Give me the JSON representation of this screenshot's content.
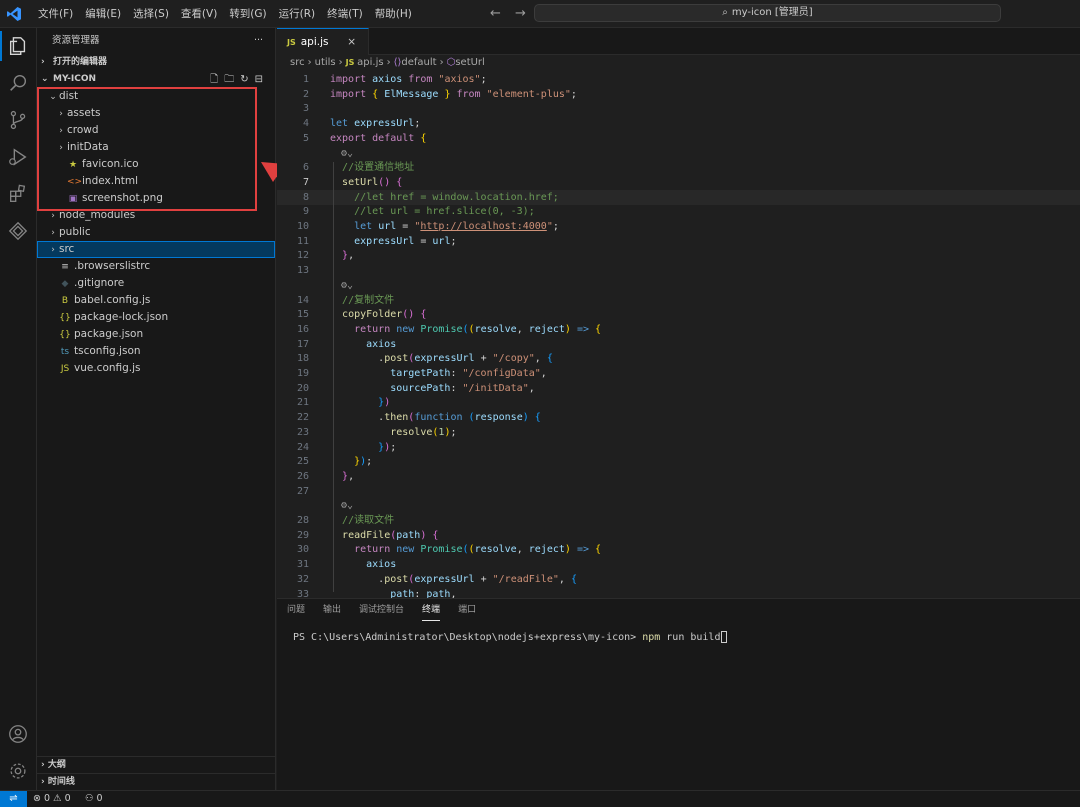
{
  "titlebar": {
    "menu": [
      "文件(F)",
      "编辑(E)",
      "选择(S)",
      "查看(V)",
      "转到(G)",
      "运行(R)",
      "终端(T)",
      "帮助(H)"
    ],
    "search_text": "my-icon [管理员]",
    "back_arrow": "←",
    "forward_arrow": "→"
  },
  "sidebar": {
    "title": "资源管理器",
    "more": "···",
    "open_editors": "打开的编辑器",
    "project": "MY-ICON",
    "tree": [
      {
        "label": "dist",
        "depth": 1,
        "chev": "⌄",
        "icon": "",
        "icon_color": ""
      },
      {
        "label": "assets",
        "depth": 2,
        "chev": "›",
        "icon": "",
        "icon_color": ""
      },
      {
        "label": "crowd",
        "depth": 2,
        "chev": "›",
        "icon": "",
        "icon_color": ""
      },
      {
        "label": "initData",
        "depth": 2,
        "chev": "›",
        "icon": "",
        "icon_color": ""
      },
      {
        "label": "favicon.ico",
        "depth": 2,
        "chev": "",
        "icon": "★",
        "icon_color": "#cbcb41"
      },
      {
        "label": "index.html",
        "depth": 2,
        "chev": "",
        "icon": "<>",
        "icon_color": "#e37933"
      },
      {
        "label": "screenshot.png",
        "depth": 2,
        "chev": "",
        "icon": "▣",
        "icon_color": "#a074c4"
      },
      {
        "label": "node_modules",
        "depth": 1,
        "chev": "›",
        "icon": "",
        "icon_color": ""
      },
      {
        "label": "public",
        "depth": 1,
        "chev": "›",
        "icon": "",
        "icon_color": ""
      },
      {
        "label": "src",
        "depth": 1,
        "chev": "›",
        "icon": "",
        "icon_color": "",
        "selected": true
      },
      {
        "label": ".browserslistrc",
        "depth": 1,
        "chev": "",
        "icon": "≡",
        "icon_color": "#cccccc"
      },
      {
        "label": ".gitignore",
        "depth": 1,
        "chev": "",
        "icon": "◆",
        "icon_color": "#41535b"
      },
      {
        "label": "babel.config.js",
        "depth": 1,
        "chev": "",
        "icon": "B",
        "icon_color": "#cbcb41"
      },
      {
        "label": "package-lock.json",
        "depth": 1,
        "chev": "",
        "icon": "{}",
        "icon_color": "#cbcb41"
      },
      {
        "label": "package.json",
        "depth": 1,
        "chev": "",
        "icon": "{}",
        "icon_color": "#cbcb41"
      },
      {
        "label": "tsconfig.json",
        "depth": 1,
        "chev": "",
        "icon": "ts",
        "icon_color": "#519aba"
      },
      {
        "label": "vue.config.js",
        "depth": 1,
        "chev": "",
        "icon": "JS",
        "icon_color": "#cbcb41"
      }
    ],
    "outline": "大纲",
    "timeline": "时间线"
  },
  "editor": {
    "tab_label": "api.js",
    "tab_close": "×",
    "breadcrumb": [
      "src",
      "utils",
      "api.js",
      "default",
      "setUrl"
    ]
  },
  "code_lines": [
    {
      "n": "1",
      "html": "<span class='kc'>import</span> <span class='var'>axios</span> <span class='kc'>from</span> <span class='str'>\"axios\"</span><span class='pn'>;</span>"
    },
    {
      "n": "2",
      "html": "<span class='kc'>import</span> <span class='br1'>{</span> <span class='var'>ElMessage</span> <span class='br1'>}</span> <span class='kc'>from</span> <span class='str'>\"element-plus\"</span><span class='pn'>;</span>"
    },
    {
      "n": "3",
      "html": ""
    },
    {
      "n": "4",
      "html": "<span class='kw'>let</span> <span class='var'>expressUrl</span><span class='pn'>;</span>"
    },
    {
      "n": "5",
      "html": "<span class='kc'>export</span> <span class='kc'>default</span> <span class='br1'>{</span>"
    },
    {
      "n": "",
      "lens": true
    },
    {
      "n": "6",
      "html": "  <span class='cm'>//设置通信地址</span>"
    },
    {
      "n": "7",
      "html": "  <span class='fn'>setUrl</span><span class='br2'>()</span> <span class='br2'>{</span>",
      "cur": true
    },
    {
      "n": "8",
      "html": "    <span class='cm'>//let href = window.location.href;</span>",
      "hl": true
    },
    {
      "n": "9",
      "html": "    <span class='cm'>//let url = href.slice(0, -3);</span>"
    },
    {
      "n": "10",
      "html": "    <span class='kw'>let</span> <span class='var'>url</span> <span class='pn'>=</span> <span class='str'>\"</span><span class='url'>http://localhost:4000</span><span class='str'>\"</span><span class='pn'>;</span>"
    },
    {
      "n": "11",
      "html": "    <span class='var'>expressUrl</span> <span class='pn'>=</span> <span class='var'>url</span><span class='pn'>;</span>"
    },
    {
      "n": "12",
      "html": "  <span class='br2'>}</span><span class='pn'>,</span>"
    },
    {
      "n": "13",
      "html": ""
    },
    {
      "n": "",
      "lens": true
    },
    {
      "n": "14",
      "html": "  <span class='cm'>//复制文件</span>"
    },
    {
      "n": "15",
      "html": "  <span class='fn'>copyFolder</span><span class='br2'>()</span> <span class='br2'>{</span>"
    },
    {
      "n": "16",
      "html": "    <span class='kc'>return</span> <span class='kw'>new</span> <span class='cls'>Promise</span><span class='br3'>(</span><span class='br1'>(</span><span class='var'>resolve</span><span class='pn'>,</span> <span class='var'>reject</span><span class='br1'>)</span> <span class='kw'>=&gt;</span> <span class='br1'>{</span>"
    },
    {
      "n": "17",
      "html": "      <span class='var'>axios</span>"
    },
    {
      "n": "18",
      "html": "        <span class='pn'>.</span><span class='fn'>post</span><span class='br2'>(</span><span class='var'>expressUrl</span> <span class='pn'>+</span> <span class='str'>\"/copy\"</span><span class='pn'>,</span> <span class='br3'>{</span>"
    },
    {
      "n": "19",
      "html": "          <span class='var'>targetPath</span><span class='pn'>:</span> <span class='str'>\"/configData\"</span><span class='pn'>,</span>"
    },
    {
      "n": "20",
      "html": "          <span class='var'>sourcePath</span><span class='pn'>:</span> <span class='str'>\"/initData\"</span><span class='pn'>,</span>"
    },
    {
      "n": "21",
      "html": "        <span class='br3'>}</span><span class='br2'>)</span>"
    },
    {
      "n": "22",
      "html": "        <span class='pn'>.</span><span class='fn'>then</span><span class='br2'>(</span><span class='kw'>function</span> <span class='br3'>(</span><span class='var'>response</span><span class='br3'>)</span> <span class='br3'>{</span>"
    },
    {
      "n": "23",
      "html": "          <span class='fn'>resolve</span><span class='br1'>(</span><span class='num'>1</span><span class='br1'>)</span><span class='pn'>;</span>"
    },
    {
      "n": "24",
      "html": "        <span class='br3'>}</span><span class='br2'>)</span><span class='pn'>;</span>"
    },
    {
      "n": "25",
      "html": "    <span class='br1'>}</span><span class='br3'>)</span><span class='pn'>;</span>"
    },
    {
      "n": "26",
      "html": "  <span class='br2'>}</span><span class='pn'>,</span>"
    },
    {
      "n": "27",
      "html": ""
    },
    {
      "n": "",
      "lens": true
    },
    {
      "n": "28",
      "html": "  <span class='cm'>//读取文件</span>"
    },
    {
      "n": "29",
      "html": "  <span class='fn'>readFile</span><span class='br2'>(</span><span class='var'>path</span><span class='br2'>)</span> <span class='br2'>{</span>"
    },
    {
      "n": "30",
      "html": "    <span class='kc'>return</span> <span class='kw'>new</span> <span class='cls'>Promise</span><span class='br3'>(</span><span class='br1'>(</span><span class='var'>resolve</span><span class='pn'>,</span> <span class='var'>reject</span><span class='br1'>)</span> <span class='kw'>=&gt;</span> <span class='br1'>{</span>"
    },
    {
      "n": "31",
      "html": "      <span class='var'>axios</span>"
    },
    {
      "n": "32",
      "html": "        <span class='pn'>.</span><span class='fn'>post</span><span class='br2'>(</span><span class='var'>expressUrl</span> <span class='pn'>+</span> <span class='str'>\"/readFile\"</span><span class='pn'>,</span> <span class='br3'>{</span>"
    },
    {
      "n": "33",
      "html": "          <span class='var'>path</span><span class='pn'>:</span> <span class='var'>path</span><span class='pn'>,</span>"
    }
  ],
  "panel": {
    "tabs": [
      "问题",
      "输出",
      "调试控制台",
      "终端",
      "端口"
    ],
    "active_tab": "终端",
    "prompt": "PS C:\\Users\\Administrator\\Desktop\\nodejs+express\\my-icon> ",
    "command": "npm",
    "args": " run build"
  },
  "statusbar": {
    "remote": "⇌",
    "problems": "⊗ 0 ⚠ 0",
    "ports": "⚇ 0"
  }
}
